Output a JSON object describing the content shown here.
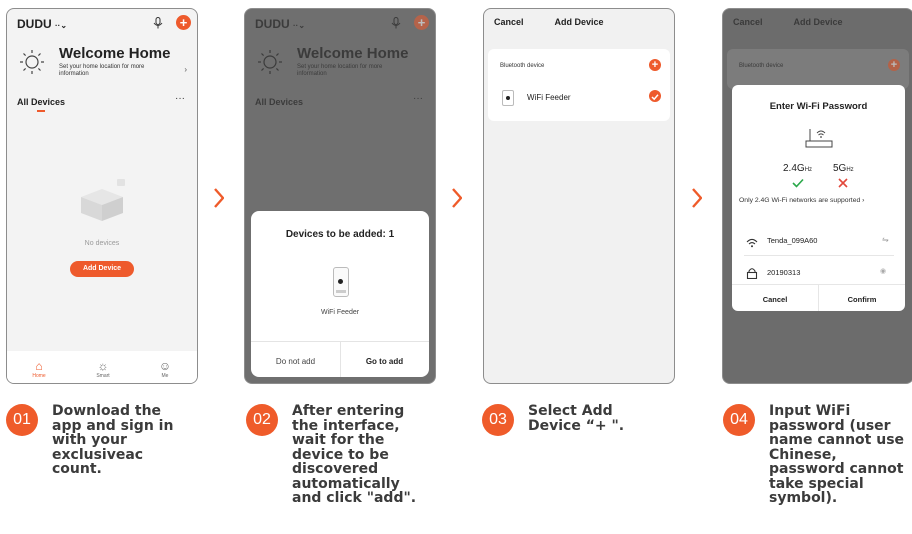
{
  "screen1": {
    "app_name": "DUDU",
    "welcome": "Welcome Home",
    "location_prompt": "Set your home location for more information",
    "all_devices": "All Devices",
    "no_devices": "No devices",
    "add_device": "Add Device",
    "tabs": [
      "Home",
      "Smart",
      "Me"
    ]
  },
  "screen2": {
    "sheet_title": "Devices to be added: 1",
    "device_name": "WiFi Feeder",
    "do_not_add": "Do not add",
    "go_to_add": "Go to add"
  },
  "screen3": {
    "cancel": "Cancel",
    "title": "Add Device",
    "section": "Bluetooth device",
    "device_name": "WiFi Feeder"
  },
  "screen4": {
    "dialog_title": "Enter Wi-Fi Password",
    "band_24": "2.4G",
    "band_5": "5G",
    "band_unit": "Hz",
    "support_note": "Only 2.4G Wi-Fi networks are supported",
    "ssid": "Tenda_099A60",
    "password": "20190313",
    "cancel": "Cancel",
    "confirm": "Confirm"
  },
  "steps": [
    {
      "num": "01",
      "text": "Download the app and sign in with your exclusiveac count."
    },
    {
      "num": "02",
      "text": "After entering the interface, wait for the device to be discovered automatically and click \"add\"."
    },
    {
      "num": "03",
      "text": "Select Add Device “+ \"."
    },
    {
      "num": "04",
      "text": "Input WiFi password (user name cannot use Chinese, password cannot take special symbol)."
    }
  ],
  "colors": {
    "accent": "#ee5a2c",
    "check_green": "#2aa84a"
  }
}
